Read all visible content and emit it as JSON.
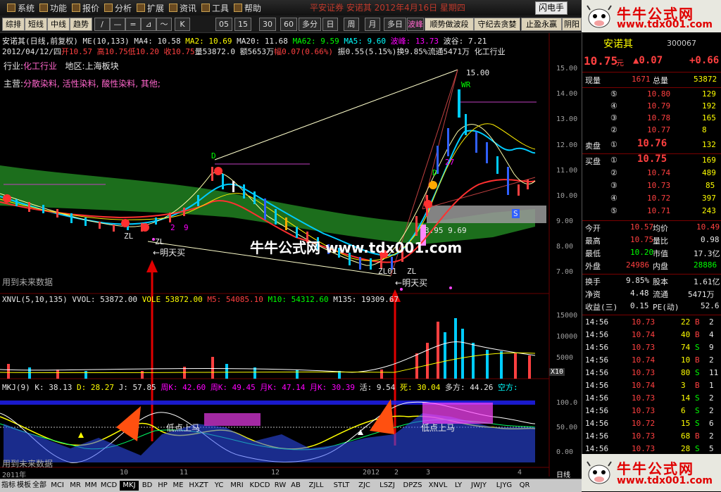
{
  "menubar": {
    "items": [
      "系统",
      "功能",
      "报价",
      "分析",
      "扩展",
      "资讯",
      "工具",
      "帮助"
    ],
    "title_text": "平安证券 安诺其 2012年4月16日 星期四",
    "flash_label": "闪电手"
  },
  "toolbar": {
    "left_buttons": [
      "综排",
      "短线",
      "中线",
      "趋势"
    ],
    "draw_tools": [
      "/",
      "—",
      "=",
      "⊿",
      "～",
      "K"
    ],
    "periods": [
      "05",
      "15",
      "30",
      "60",
      "多分",
      "日",
      "周",
      "月",
      "多日"
    ],
    "right_buttons": [
      "波峰",
      "顺势做波段",
      "守纪去贪婪",
      "止盈永赢",
      "阴阳"
    ]
  },
  "header": {
    "line1": {
      "name": "安诺其(日线,前复权)",
      "me": "ME(10,133)",
      "ma4": "MA4: 10.58",
      "ma2": "MA2: 10.69",
      "ma20": "MA20: 11.68",
      "ma62": "MA62: 9.59",
      "ma5": "MA5: 9.60",
      "peak": "波峰: 13.73",
      "valley": "波谷: 7.21"
    },
    "line2": {
      "date": "2012/04/12/四",
      "open": "开10.57",
      "high": "高10.75",
      "low": "低10.20",
      "close": "收10.75",
      "vol": "量53872.0",
      "amt": "额5653万",
      "chg": "幅0.07(0.66%)",
      "amp": "振0.55(5.15%)",
      "turn": "换9.85%",
      "float": "流通5471万",
      "ind": "化工行业"
    },
    "industry_label": "行业:",
    "industry": "化工行业",
    "region_label": "地区:",
    "region": "上海板块",
    "main_label": "主营:",
    "main": "分散染料, 活性染料, 酸性染料, 其他;"
  },
  "annotations": {
    "peak_price": "15.00",
    "range_text": "3.95 9.69",
    "zl": "ZL",
    "zl01": "ZL01",
    "buy_tomorrow": "明天买",
    "future_note": "用到未来数据",
    "bottom_label": "低点上马",
    "label_27": "27",
    "label_2": "2",
    "label_9": "9",
    "label_D": "D",
    "label_WR": "WR",
    "label_S": "S"
  },
  "watermark": "牛牛公式网 www.tdx001.com",
  "vol_header": {
    "name": "XNVL(5,10,135)",
    "vvol": "VVOL: 53872.00",
    "vole": "VOLE 53872.00",
    "m5": "M5: 54085.10",
    "m10": "M10: 54312.60",
    "m135": "M135: 19309.67"
  },
  "kdj_header": {
    "name": "MKJ(9)",
    "k": "K: 38.13",
    "d": "D: 28.27",
    "j": "J: 57.85",
    "wk": "周K: 42.60",
    "wk2": "周K: 49.45",
    "mk": "月K: 47.14",
    "mk2": "月K: 30.39",
    "huo": "活: 9.54",
    "si": "死: 30.04",
    "long": "多方: 44.26",
    "short": "空方:"
  },
  "price_axis": [
    "15.00",
    "14.00",
    "13.00",
    "12.00",
    "11.00",
    "10.00",
    "9.00",
    "8.00",
    "7.00"
  ],
  "vol_axis": [
    "15000",
    "10000",
    "5000"
  ],
  "vol_unit": "X10",
  "kdj_axis": [
    "100.0",
    "50.00",
    "0.00"
  ],
  "date_axis": [
    "2011年",
    "10",
    "11",
    "12",
    "2012",
    "2",
    "3",
    "4"
  ],
  "date_axis_right": "日线",
  "quote": {
    "name": "安诺其",
    "code": "300067",
    "price": "10.75",
    "unit": "元",
    "change": "▲0.07",
    "change_pct": "+0.66",
    "now_vol_label": "现量",
    "now_vol": "1671",
    "total_vol_label": "总量",
    "total_vol": "53872",
    "asks": [
      {
        "lvl": "⑤",
        "price": "10.80",
        "vol": "129"
      },
      {
        "lvl": "④",
        "price": "10.79",
        "vol": "192"
      },
      {
        "lvl": "③",
        "price": "10.78",
        "vol": "165"
      },
      {
        "lvl": "②",
        "price": "10.77",
        "vol": "8"
      }
    ],
    "ask1_label": "卖盘",
    "ask1_lvl": "①",
    "ask1_price": "10.76",
    "ask1_vol": "132",
    "bid1_label": "买盘",
    "bid1_lvl": "①",
    "bid1_price": "10.75",
    "bid1_vol": "169",
    "bids": [
      {
        "lvl": "②",
        "price": "10.74",
        "vol": "489"
      },
      {
        "lvl": "③",
        "price": "10.73",
        "vol": "85"
      },
      {
        "lvl": "④",
        "price": "10.72",
        "vol": "397"
      },
      {
        "lvl": "⑤",
        "price": "10.71",
        "vol": "243"
      }
    ],
    "stats": [
      {
        "l1": "今开",
        "v1": "10.57",
        "l2": "均价",
        "v2": "10.49"
      },
      {
        "l1": "最高",
        "v1": "10.75",
        "l2": "量比",
        "v2": "0.98"
      },
      {
        "l1": "最低",
        "v1": "10.20",
        "l2": "市值",
        "v2": "17.3亿"
      },
      {
        "l1": "外盘",
        "v1": "24986",
        "l2": "内盘",
        "v2": "28886"
      }
    ],
    "stats2": [
      {
        "l1": "换手",
        "v1": "9.85%",
        "l2": "股本",
        "v2": "1.61亿"
      },
      {
        "l1": "净资",
        "v1": "4.48",
        "l2": "流通",
        "v2": "5471万"
      },
      {
        "l1": "收益(三)",
        "v1": "0.15",
        "l2": "PE(动)",
        "v2": "52.6"
      }
    ],
    "ticks": [
      {
        "t": "14:56",
        "p": "10.73",
        "v": "22",
        "s": "B",
        "n": "2"
      },
      {
        "t": "14:56",
        "p": "10.74",
        "v": "40",
        "s": "B",
        "n": "4"
      },
      {
        "t": "14:56",
        "p": "10.73",
        "v": "74",
        "s": "S",
        "n": "9"
      },
      {
        "t": "14:56",
        "p": "10.74",
        "v": "10",
        "s": "B",
        "n": "2"
      },
      {
        "t": "14:56",
        "p": "10.73",
        "v": "80",
        "s": "S",
        "n": "11"
      },
      {
        "t": "14:56",
        "p": "10.74",
        "v": "3",
        "s": "B",
        "n": "1"
      },
      {
        "t": "14:56",
        "p": "10.73",
        "v": "14",
        "s": "S",
        "n": "2"
      },
      {
        "t": "14:56",
        "p": "10.73",
        "v": "6",
        "s": "S",
        "n": "2"
      },
      {
        "t": "14:56",
        "p": "10.72",
        "v": "15",
        "s": "S",
        "n": "6"
      },
      {
        "t": "14:56",
        "p": "10.73",
        "v": "68",
        "s": "B",
        "n": "2"
      },
      {
        "t": "14:56",
        "p": "10.73",
        "v": "28",
        "s": "S",
        "n": "5"
      }
    ]
  },
  "banner": {
    "title": "牛牛公式网",
    "url": "www.tdx001.com"
  },
  "tabs": [
    "指标",
    "模板",
    "全部",
    "MCI",
    "MR",
    "MM",
    "MCD",
    "MKJ",
    "BD",
    "HP",
    "ME",
    "HXZT",
    "YC",
    "MRI",
    "KDCD",
    "RW",
    "AB",
    "ZJLL",
    "STLT",
    "ZJC",
    "LSZJ",
    "DPZS",
    "XNVL",
    "LY",
    "JWJY",
    "LJYG",
    "QR"
  ],
  "colors": {
    "up": "#ff4040",
    "down": "#00ffff",
    "bg": "#000000",
    "grid": "#6a0000",
    "accent": "#ffff00"
  }
}
